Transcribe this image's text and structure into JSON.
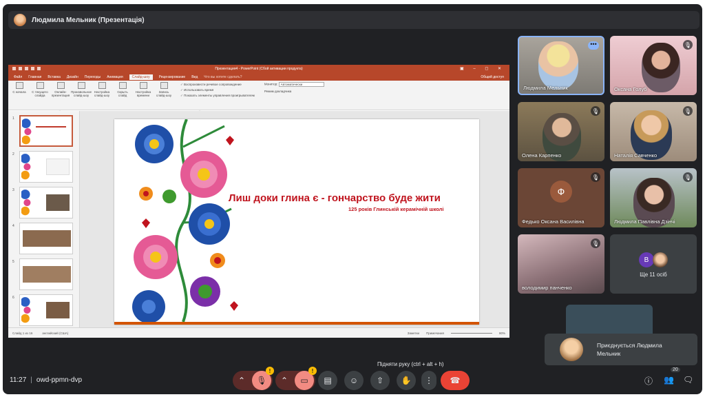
{
  "header": {
    "title": "Людмила Мельник (Презентація)"
  },
  "ppt": {
    "window_title": "Презентация4 - PowerPoint (Сбой активации продукта)",
    "tabs": [
      "Файл",
      "Главная",
      "Вставка",
      "Дизайн",
      "Переходы",
      "Анимация",
      "Слайд-шоу",
      "Рецензирование",
      "Вид"
    ],
    "help": "Что вы хотите сделать?",
    "share": "Общий доступ",
    "ribbon": {
      "btn1": "С начала",
      "btn2": "С текущего слайда",
      "btn3": "Онлайн-презентация",
      "btn4": "Произвольное слайд-шоу",
      "btn5": "Настройка слайд-шоу",
      "btn6": "Скрыть слайд",
      "btn7": "Настройка времени",
      "btn8": "Запись слайд-шоу",
      "check1": "Воспроизвести речевое сопровождение",
      "check2": "Использовать время",
      "check3": "Показать элементы управления проигрывателем",
      "monitor_label": "Монитор:",
      "monitor_value": "Автоматически",
      "presenter_mode": "Режим докладчика",
      "group1": "Начать слайд-шоу",
      "group2": "Настройка",
      "group3": "Мониторы"
    },
    "slide_title": "Лиш доки глина є - гончарство буде жити",
    "slide_subtitle": "125 років Глинській керамічній школі",
    "status_left": "Слайд 1 из 16",
    "status_lang": "английский (США)",
    "status_notes": "Заметки",
    "status_comments": "Примечания",
    "zoom": "80%"
  },
  "participants": [
    {
      "name": "Людмила Мельник"
    },
    {
      "name": "Оксана Голуб"
    },
    {
      "name": "Олена Карпенко"
    },
    {
      "name": "Наталія Савченко"
    },
    {
      "name": "Федько Оксана Василівна",
      "initial": "Ф"
    },
    {
      "name": "Людмила Павлівна Дзінчі"
    },
    {
      "name": "володимир панченко"
    }
  ],
  "others": {
    "initial": "B",
    "label": "Ще 11 осіб"
  },
  "toast": {
    "text": "Приєднується Людмила Мельник"
  },
  "tooltip": "Підняти руку (ctrl + alt + h)",
  "bottom": {
    "time": "11:27",
    "meeting_code": "owd-ppmn-dvp",
    "people_count": "20"
  }
}
